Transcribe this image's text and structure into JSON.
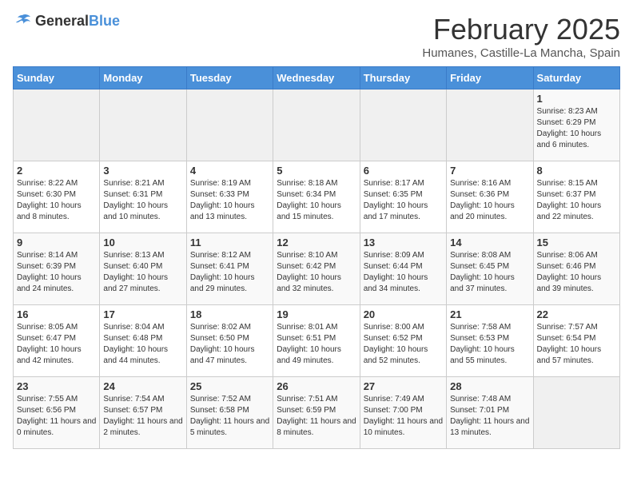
{
  "header": {
    "logo_general": "General",
    "logo_blue": "Blue",
    "title": "February 2025",
    "subtitle": "Humanes, Castille-La Mancha, Spain"
  },
  "weekdays": [
    "Sunday",
    "Monday",
    "Tuesday",
    "Wednesday",
    "Thursday",
    "Friday",
    "Saturday"
  ],
  "weeks": [
    [
      {
        "day": "",
        "text": ""
      },
      {
        "day": "",
        "text": ""
      },
      {
        "day": "",
        "text": ""
      },
      {
        "day": "",
        "text": ""
      },
      {
        "day": "",
        "text": ""
      },
      {
        "day": "",
        "text": ""
      },
      {
        "day": "1",
        "text": "Sunrise: 8:23 AM\nSunset: 6:29 PM\nDaylight: 10 hours and 6 minutes."
      }
    ],
    [
      {
        "day": "2",
        "text": "Sunrise: 8:22 AM\nSunset: 6:30 PM\nDaylight: 10 hours and 8 minutes."
      },
      {
        "day": "3",
        "text": "Sunrise: 8:21 AM\nSunset: 6:31 PM\nDaylight: 10 hours and 10 minutes."
      },
      {
        "day": "4",
        "text": "Sunrise: 8:19 AM\nSunset: 6:33 PM\nDaylight: 10 hours and 13 minutes."
      },
      {
        "day": "5",
        "text": "Sunrise: 8:18 AM\nSunset: 6:34 PM\nDaylight: 10 hours and 15 minutes."
      },
      {
        "day": "6",
        "text": "Sunrise: 8:17 AM\nSunset: 6:35 PM\nDaylight: 10 hours and 17 minutes."
      },
      {
        "day": "7",
        "text": "Sunrise: 8:16 AM\nSunset: 6:36 PM\nDaylight: 10 hours and 20 minutes."
      },
      {
        "day": "8",
        "text": "Sunrise: 8:15 AM\nSunset: 6:37 PM\nDaylight: 10 hours and 22 minutes."
      }
    ],
    [
      {
        "day": "9",
        "text": "Sunrise: 8:14 AM\nSunset: 6:39 PM\nDaylight: 10 hours and 24 minutes."
      },
      {
        "day": "10",
        "text": "Sunrise: 8:13 AM\nSunset: 6:40 PM\nDaylight: 10 hours and 27 minutes."
      },
      {
        "day": "11",
        "text": "Sunrise: 8:12 AM\nSunset: 6:41 PM\nDaylight: 10 hours and 29 minutes."
      },
      {
        "day": "12",
        "text": "Sunrise: 8:10 AM\nSunset: 6:42 PM\nDaylight: 10 hours and 32 minutes."
      },
      {
        "day": "13",
        "text": "Sunrise: 8:09 AM\nSunset: 6:44 PM\nDaylight: 10 hours and 34 minutes."
      },
      {
        "day": "14",
        "text": "Sunrise: 8:08 AM\nSunset: 6:45 PM\nDaylight: 10 hours and 37 minutes."
      },
      {
        "day": "15",
        "text": "Sunrise: 8:06 AM\nSunset: 6:46 PM\nDaylight: 10 hours and 39 minutes."
      }
    ],
    [
      {
        "day": "16",
        "text": "Sunrise: 8:05 AM\nSunset: 6:47 PM\nDaylight: 10 hours and 42 minutes."
      },
      {
        "day": "17",
        "text": "Sunrise: 8:04 AM\nSunset: 6:48 PM\nDaylight: 10 hours and 44 minutes."
      },
      {
        "day": "18",
        "text": "Sunrise: 8:02 AM\nSunset: 6:50 PM\nDaylight: 10 hours and 47 minutes."
      },
      {
        "day": "19",
        "text": "Sunrise: 8:01 AM\nSunset: 6:51 PM\nDaylight: 10 hours and 49 minutes."
      },
      {
        "day": "20",
        "text": "Sunrise: 8:00 AM\nSunset: 6:52 PM\nDaylight: 10 hours and 52 minutes."
      },
      {
        "day": "21",
        "text": "Sunrise: 7:58 AM\nSunset: 6:53 PM\nDaylight: 10 hours and 55 minutes."
      },
      {
        "day": "22",
        "text": "Sunrise: 7:57 AM\nSunset: 6:54 PM\nDaylight: 10 hours and 57 minutes."
      }
    ],
    [
      {
        "day": "23",
        "text": "Sunrise: 7:55 AM\nSunset: 6:56 PM\nDaylight: 11 hours and 0 minutes."
      },
      {
        "day": "24",
        "text": "Sunrise: 7:54 AM\nSunset: 6:57 PM\nDaylight: 11 hours and 2 minutes."
      },
      {
        "day": "25",
        "text": "Sunrise: 7:52 AM\nSunset: 6:58 PM\nDaylight: 11 hours and 5 minutes."
      },
      {
        "day": "26",
        "text": "Sunrise: 7:51 AM\nSunset: 6:59 PM\nDaylight: 11 hours and 8 minutes."
      },
      {
        "day": "27",
        "text": "Sunrise: 7:49 AM\nSunset: 7:00 PM\nDaylight: 11 hours and 10 minutes."
      },
      {
        "day": "28",
        "text": "Sunrise: 7:48 AM\nSunset: 7:01 PM\nDaylight: 11 hours and 13 minutes."
      },
      {
        "day": "",
        "text": ""
      }
    ]
  ]
}
